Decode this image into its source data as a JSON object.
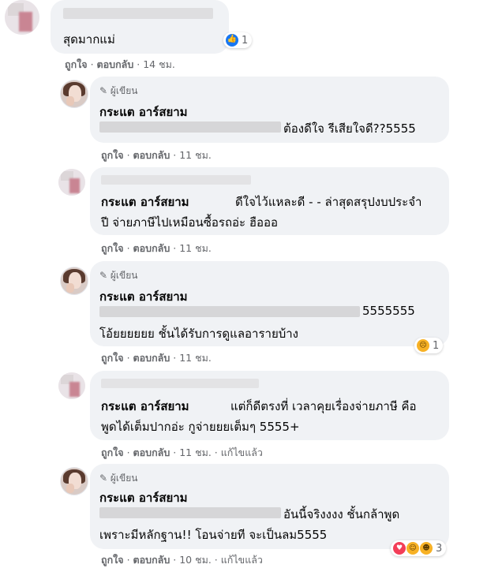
{
  "author_badge": "ผู้เขียน",
  "comments": [
    {
      "text": "สุดมากแม่",
      "meta": {
        "like": "ถูกใจ",
        "reply": "ตอบกลับ",
        "time": "14 ชม."
      },
      "reaction": {
        "icons": [
          "like-icon"
        ],
        "count": "1"
      }
    },
    {
      "author": "กระแต อาร์สยาม",
      "text": "ต้องดีใจ รีเสียใจดี??5555",
      "meta": {
        "like": "ถูกใจ",
        "reply": "ตอบกลับ",
        "time": "11 ชม."
      }
    },
    {
      "author": "กระแต อาร์สยาม",
      "text1": "ดีใจไว้แหละดี - - ล่าสุดสรุปงบประจำ",
      "text2": "ปี จ่ายภาษีไปเหมือนซื้อรถอ่ะ ฮือออ",
      "meta": {
        "like": "ถูกใจ",
        "reply": "ตอบกลับ",
        "time": "11 ชม."
      }
    },
    {
      "author": "กระแต อาร์สยาม",
      "text1": "5555555",
      "text2": "โอ้ยยยยยย ชั้นได้รับการดูแลอารายบ้าง",
      "meta": {
        "like": "ถูกใจ",
        "reply": "ตอบกลับ",
        "time": "11 ชม."
      },
      "reaction": {
        "icons": [
          "sad-icon"
        ],
        "count": "1"
      }
    },
    {
      "author": "กระแต อาร์สยาม",
      "text1": "แต่ก็ดีตรงที่ เวลาคุยเรื่องจ่ายภาษี คือ",
      "text2": "พูดได้เต็มปากอ่ะ กูจ่ายยยเต็มๆ 5555+",
      "meta": {
        "like": "ถูกใจ",
        "reply": "ตอบกลับ",
        "time": "11 ชม.",
        "edited": "แก้ไขแล้ว"
      }
    },
    {
      "author": "กระแต อาร์สยาม",
      "text1": "อันนี้จริงงงง ชั้นกล้าพูด",
      "text2": "เพราะมีหลักฐาน!! โอนจ่ายที จะเป็นลม5555",
      "meta": {
        "like": "ถูกใจ",
        "reply": "ตอบกลับ",
        "time": "10 ชม.",
        "edited": "แก้ไขแล้ว"
      },
      "reaction": {
        "icons": [
          "love-icon",
          "haha-icon",
          "care-icon"
        ],
        "count": "3"
      }
    }
  ],
  "separator": "·",
  "colors": {
    "bubble": "#f0f2f5",
    "meta": "#65676b",
    "like_blue": "#1877f2"
  }
}
